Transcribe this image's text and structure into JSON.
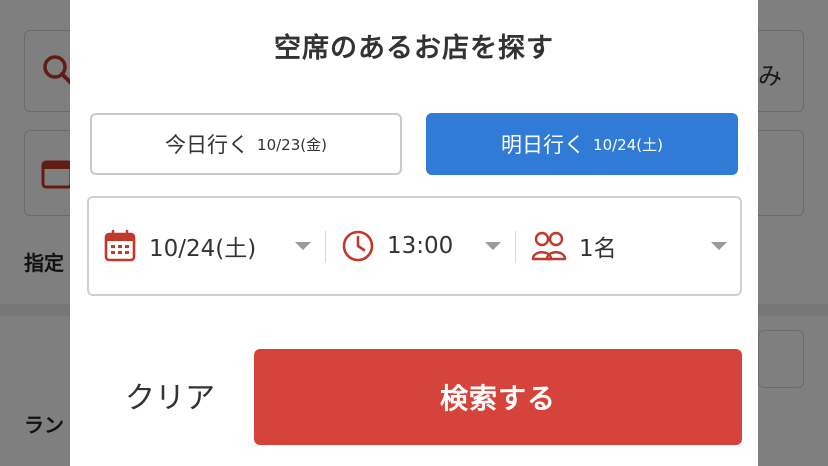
{
  "background": {
    "search_suffix": "み",
    "designated_label": "指定",
    "ranking_label": "ラン"
  },
  "modal": {
    "title": "空席のあるお店を探す",
    "day_options": [
      {
        "label": "今日行く",
        "date": "10/23(金)",
        "selected": false
      },
      {
        "label": "明日行く",
        "date": "10/24(土)",
        "selected": true
      }
    ],
    "selectors": {
      "date": {
        "value": "10/24(土)",
        "icon": "calendar-icon"
      },
      "time": {
        "value": "13:00",
        "icon": "clock-icon"
      },
      "people": {
        "value": "1名",
        "icon": "people-icon"
      }
    },
    "clear_label": "クリア",
    "search_label": "検索する"
  },
  "colors": {
    "accent_blue": "#2f7bd6",
    "accent_red": "#d5433a",
    "icon_red": "#c0392b"
  }
}
